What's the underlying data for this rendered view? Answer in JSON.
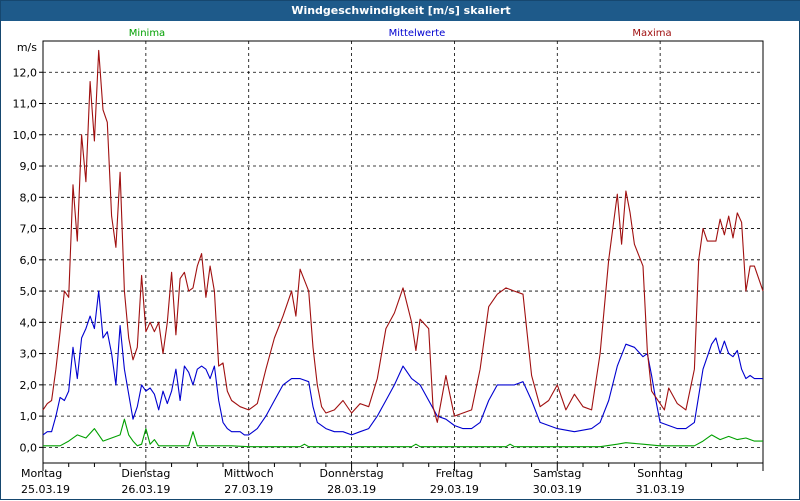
{
  "window": {
    "title": "Windgeschwindigkeit [m/s] skaliert"
  },
  "chart_data": {
    "type": "line",
    "title": "Windgeschwindigkeit [m/s] skaliert",
    "ylabel": "m/s",
    "ylim": [
      -0.5,
      13
    ],
    "yticks": [
      0,
      1,
      2,
      3,
      4,
      5,
      6,
      7,
      8,
      9,
      10,
      11,
      12
    ],
    "ytick_labels": [
      "0,0",
      "1,0",
      "2,0",
      "3,0",
      "4,0",
      "5,0",
      "6,0",
      "7,0",
      "8,0",
      "9,0",
      "10,0",
      "11,0",
      "12,0"
    ],
    "xlim": [
      0,
      168
    ],
    "x_unit": "hours since 25.03.19 00:00",
    "x_ticks": [
      {
        "x": 0,
        "day": "Montag",
        "date": "25.03.19"
      },
      {
        "x": 24,
        "day": "Dienstag",
        "date": "26.03.19"
      },
      {
        "x": 48,
        "day": "Mittwoch",
        "date": "27.03.19"
      },
      {
        "x": 72,
        "day": "Donnerstag",
        "date": "28.03.19"
      },
      {
        "x": 96,
        "day": "Freitag",
        "date": "29.03.19"
      },
      {
        "x": 120,
        "day": "Samstag",
        "date": "30.03.19"
      },
      {
        "x": 144,
        "day": "Sonntag",
        "date": "31.03.19"
      }
    ],
    "grid": {
      "vertical_hours": [
        24,
        48,
        72,
        96,
        120,
        144
      ],
      "horizontal": true
    },
    "series": [
      {
        "name": "Minima",
        "color": "#00a000",
        "points": [
          [
            0,
            0.05
          ],
          [
            4,
            0.05
          ],
          [
            6,
            0.2
          ],
          [
            8,
            0.4
          ],
          [
            10,
            0.3
          ],
          [
            12,
            0.6
          ],
          [
            14,
            0.2
          ],
          [
            16,
            0.3
          ],
          [
            18,
            0.4
          ],
          [
            19,
            0.9
          ],
          [
            20,
            0.4
          ],
          [
            21,
            0.2
          ],
          [
            22,
            0.05
          ],
          [
            23,
            0.1
          ],
          [
            24,
            0.6
          ],
          [
            25,
            0.1
          ],
          [
            26,
            0.25
          ],
          [
            27,
            0.05
          ],
          [
            30,
            0.05
          ],
          [
            34,
            0.05
          ],
          [
            35,
            0.5
          ],
          [
            36,
            0.05
          ],
          [
            40,
            0.05
          ],
          [
            44,
            0.05
          ],
          [
            48,
            0.02
          ],
          [
            60,
            0.02
          ],
          [
            61,
            0.1
          ],
          [
            62,
            0.02
          ],
          [
            80,
            0.02
          ],
          [
            86,
            0.02
          ],
          [
            87,
            0.1
          ],
          [
            88,
            0.02
          ],
          [
            96,
            0.02
          ],
          [
            108,
            0.02
          ],
          [
            109,
            0.1
          ],
          [
            110,
            0.02
          ],
          [
            120,
            0.02
          ],
          [
            130,
            0.02
          ],
          [
            134,
            0.1
          ],
          [
            136,
            0.15
          ],
          [
            140,
            0.1
          ],
          [
            144,
            0.05
          ],
          [
            148,
            0.05
          ],
          [
            152,
            0.05
          ],
          [
            154,
            0.2
          ],
          [
            156,
            0.4
          ],
          [
            158,
            0.25
          ],
          [
            160,
            0.35
          ],
          [
            162,
            0.25
          ],
          [
            164,
            0.3
          ],
          [
            166,
            0.2
          ],
          [
            168,
            0.2
          ]
        ]
      },
      {
        "name": "Mittelwerte",
        "color": "#0000d0",
        "points": [
          [
            0,
            0.4
          ],
          [
            1,
            0.5
          ],
          [
            2,
            0.5
          ],
          [
            3,
            1.0
          ],
          [
            4,
            1.6
          ],
          [
            5,
            1.5
          ],
          [
            6,
            1.8
          ],
          [
            7,
            3.2
          ],
          [
            8,
            2.2
          ],
          [
            9,
            3.5
          ],
          [
            10,
            3.8
          ],
          [
            11,
            4.2
          ],
          [
            12,
            3.8
          ],
          [
            13,
            5.0
          ],
          [
            14,
            3.5
          ],
          [
            15,
            3.7
          ],
          [
            16,
            3.0
          ],
          [
            17,
            2.0
          ],
          [
            18,
            3.9
          ],
          [
            19,
            2.5
          ],
          [
            20,
            1.7
          ],
          [
            21,
            0.9
          ],
          [
            22,
            1.3
          ],
          [
            23,
            2.0
          ],
          [
            24,
            1.8
          ],
          [
            25,
            1.9
          ],
          [
            26,
            1.7
          ],
          [
            27,
            1.2
          ],
          [
            28,
            1.8
          ],
          [
            29,
            1.4
          ],
          [
            30,
            1.8
          ],
          [
            31,
            2.5
          ],
          [
            32,
            1.5
          ],
          [
            33,
            2.6
          ],
          [
            34,
            2.4
          ],
          [
            35,
            2.0
          ],
          [
            36,
            2.5
          ],
          [
            37,
            2.6
          ],
          [
            38,
            2.5
          ],
          [
            39,
            2.2
          ],
          [
            40,
            2.6
          ],
          [
            41,
            1.5
          ],
          [
            42,
            0.8
          ],
          [
            43,
            0.6
          ],
          [
            44,
            0.5
          ],
          [
            45,
            0.5
          ],
          [
            46,
            0.5
          ],
          [
            47,
            0.4
          ],
          [
            48,
            0.4
          ],
          [
            50,
            0.6
          ],
          [
            52,
            1.0
          ],
          [
            54,
            1.5
          ],
          [
            56,
            2.0
          ],
          [
            58,
            2.2
          ],
          [
            60,
            2.2
          ],
          [
            62,
            2.1
          ],
          [
            63,
            1.3
          ],
          [
            64,
            0.8
          ],
          [
            66,
            0.6
          ],
          [
            68,
            0.5
          ],
          [
            70,
            0.5
          ],
          [
            72,
            0.4
          ],
          [
            74,
            0.5
          ],
          [
            76,
            0.6
          ],
          [
            78,
            1.0
          ],
          [
            80,
            1.5
          ],
          [
            82,
            2.0
          ],
          [
            84,
            2.6
          ],
          [
            86,
            2.2
          ],
          [
            88,
            2.0
          ],
          [
            90,
            1.5
          ],
          [
            92,
            1.0
          ],
          [
            94,
            0.9
          ],
          [
            96,
            0.7
          ],
          [
            98,
            0.6
          ],
          [
            100,
            0.6
          ],
          [
            102,
            0.8
          ],
          [
            104,
            1.5
          ],
          [
            106,
            2.0
          ],
          [
            108,
            2.0
          ],
          [
            110,
            2.0
          ],
          [
            112,
            2.1
          ],
          [
            114,
            1.5
          ],
          [
            116,
            0.8
          ],
          [
            118,
            0.7
          ],
          [
            120,
            0.6
          ],
          [
            124,
            0.5
          ],
          [
            128,
            0.6
          ],
          [
            130,
            0.8
          ],
          [
            132,
            1.5
          ],
          [
            134,
            2.6
          ],
          [
            136,
            3.3
          ],
          [
            138,
            3.2
          ],
          [
            140,
            2.9
          ],
          [
            141,
            3.0
          ],
          [
            142,
            2.3
          ],
          [
            143,
            1.5
          ],
          [
            144,
            0.8
          ],
          [
            146,
            0.7
          ],
          [
            148,
            0.6
          ],
          [
            150,
            0.6
          ],
          [
            152,
            0.8
          ],
          [
            154,
            2.5
          ],
          [
            156,
            3.3
          ],
          [
            157,
            3.5
          ],
          [
            158,
            3.0
          ],
          [
            159,
            3.4
          ],
          [
            160,
            3.0
          ],
          [
            161,
            2.9
          ],
          [
            162,
            3.1
          ],
          [
            163,
            2.5
          ],
          [
            164,
            2.2
          ],
          [
            165,
            2.3
          ],
          [
            166,
            2.2
          ],
          [
            168,
            2.2
          ]
        ]
      },
      {
        "name": "Maxima",
        "color": "#a01010",
        "points": [
          [
            0,
            1.2
          ],
          [
            1,
            1.4
          ],
          [
            2,
            1.5
          ],
          [
            3,
            2.5
          ],
          [
            4,
            3.7
          ],
          [
            5,
            5.0
          ],
          [
            6,
            4.8
          ],
          [
            7,
            8.4
          ],
          [
            8,
            6.6
          ],
          [
            9,
            10.0
          ],
          [
            10,
            8.5
          ],
          [
            11,
            11.7
          ],
          [
            12,
            9.8
          ],
          [
            13,
            12.7
          ],
          [
            14,
            10.8
          ],
          [
            15,
            10.4
          ],
          [
            16,
            7.4
          ],
          [
            17,
            6.4
          ],
          [
            18,
            8.8
          ],
          [
            19,
            5.0
          ],
          [
            20,
            3.5
          ],
          [
            21,
            2.8
          ],
          [
            22,
            3.2
          ],
          [
            23,
            5.5
          ],
          [
            24,
            3.7
          ],
          [
            25,
            4.0
          ],
          [
            26,
            3.7
          ],
          [
            27,
            4.0
          ],
          [
            28,
            3.0
          ],
          [
            29,
            4.0
          ],
          [
            30,
            5.6
          ],
          [
            31,
            3.6
          ],
          [
            32,
            5.4
          ],
          [
            33,
            5.6
          ],
          [
            34,
            5.0
          ],
          [
            35,
            5.1
          ],
          [
            36,
            5.8
          ],
          [
            37,
            6.2
          ],
          [
            38,
            4.8
          ],
          [
            39,
            5.8
          ],
          [
            40,
            5.0
          ],
          [
            41,
            2.6
          ],
          [
            42,
            2.7
          ],
          [
            43,
            1.8
          ],
          [
            44,
            1.5
          ],
          [
            46,
            1.3
          ],
          [
            48,
            1.2
          ],
          [
            50,
            1.4
          ],
          [
            52,
            2.5
          ],
          [
            54,
            3.5
          ],
          [
            56,
            4.2
          ],
          [
            58,
            5.0
          ],
          [
            59,
            4.2
          ],
          [
            60,
            5.7
          ],
          [
            62,
            5.0
          ],
          [
            63,
            3.2
          ],
          [
            64,
            2.0
          ],
          [
            65,
            1.3
          ],
          [
            66,
            1.1
          ],
          [
            68,
            1.2
          ],
          [
            70,
            1.5
          ],
          [
            72,
            1.1
          ],
          [
            74,
            1.4
          ],
          [
            76,
            1.3
          ],
          [
            78,
            2.2
          ],
          [
            80,
            3.8
          ],
          [
            82,
            4.3
          ],
          [
            84,
            5.1
          ],
          [
            86,
            4.0
          ],
          [
            87,
            3.1
          ],
          [
            88,
            4.1
          ],
          [
            90,
            3.8
          ],
          [
            91,
            1.3
          ],
          [
            92,
            0.8
          ],
          [
            94,
            2.3
          ],
          [
            96,
            1.0
          ],
          [
            98,
            1.1
          ],
          [
            100,
            1.2
          ],
          [
            102,
            2.5
          ],
          [
            104,
            4.5
          ],
          [
            106,
            4.9
          ],
          [
            108,
            5.1
          ],
          [
            110,
            5.0
          ],
          [
            112,
            4.9
          ],
          [
            114,
            2.3
          ],
          [
            116,
            1.3
          ],
          [
            118,
            1.5
          ],
          [
            120,
            2.0
          ],
          [
            122,
            1.2
          ],
          [
            124,
            1.7
          ],
          [
            126,
            1.3
          ],
          [
            128,
            1.2
          ],
          [
            130,
            3.0
          ],
          [
            132,
            6.0
          ],
          [
            134,
            8.1
          ],
          [
            135,
            6.5
          ],
          [
            136,
            8.2
          ],
          [
            137,
            7.5
          ],
          [
            138,
            6.5
          ],
          [
            140,
            5.8
          ],
          [
            141,
            3.1
          ],
          [
            142,
            1.8
          ],
          [
            144,
            1.4
          ],
          [
            145,
            1.2
          ],
          [
            146,
            1.9
          ],
          [
            148,
            1.4
          ],
          [
            150,
            1.2
          ],
          [
            152,
            2.5
          ],
          [
            153,
            6.0
          ],
          [
            154,
            7.0
          ],
          [
            155,
            6.6
          ],
          [
            157,
            6.6
          ],
          [
            158,
            7.3
          ],
          [
            159,
            6.8
          ],
          [
            160,
            7.4
          ],
          [
            161,
            6.7
          ],
          [
            162,
            7.5
          ],
          [
            163,
            7.2
          ],
          [
            164,
            5.0
          ],
          [
            165,
            5.8
          ],
          [
            166,
            5.8
          ],
          [
            168,
            5.0
          ]
        ]
      }
    ]
  }
}
